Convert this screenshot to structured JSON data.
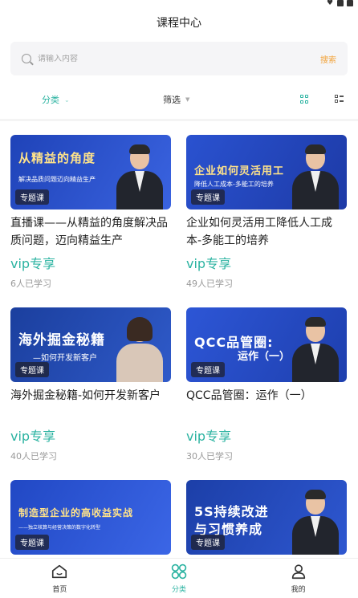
{
  "app": {
    "title": "课程中心"
  },
  "search": {
    "placeholder": "请输入内容",
    "button_label": "搜索"
  },
  "filters": {
    "category_label": "分类",
    "sort_label": "筛选"
  },
  "courses": [
    {
      "thumb_title": "从精益的角度",
      "thumb_subtitle": "解决品质问题迈向精益生产",
      "badge": "专题课",
      "title": "直播课——从精益的角度解决品质问题，迈向精益生产",
      "price": "vip专享",
      "learners": "6人已学习",
      "bg": "#1f43b8"
    },
    {
      "thumb_title": "企业如何灵活用工",
      "thumb_subtitle": "降低人工成本-多能工的培养",
      "badge": "专题课",
      "title": "企业如何灵活用工降低人工成本-多能工的培养",
      "price": "vip专享",
      "learners": "49人已学习",
      "bg": "#2a52d0"
    },
    {
      "thumb_title": "海外掘金秘籍",
      "thumb_subtitle": "—如何开发新客户",
      "badge": "专题课",
      "title": "海外掘金秘籍-如何开发新客户",
      "price": "vip专享",
      "learners": "40人已学习",
      "bg": "#1b3f9e"
    },
    {
      "thumb_title": "QCC品管圈:",
      "thumb_subtitle": "运作（一）",
      "badge": "专题课",
      "title": "QCC品管圈：运作（一）",
      "price": "vip专享",
      "learners": "30人已学习",
      "bg": "#2d56d6"
    },
    {
      "thumb_title": "制造型企业的高收益实战",
      "thumb_subtitle": "——独立核算与经营决策的数字化转型",
      "badge": "专题课",
      "title": "",
      "price": "",
      "learners": "",
      "bg": "#2148c4"
    },
    {
      "thumb_title": "5S持续改进",
      "thumb_subtitle": "与习惯养成",
      "badge": "专题课",
      "title": "",
      "price": "",
      "learners": "",
      "bg": "#1c3fa8"
    }
  ],
  "tabbar": {
    "home": "首页",
    "category": "分类",
    "mine": "我的"
  },
  "colors": {
    "accent": "#2bb3a1",
    "search_button": "#f2a33a"
  }
}
